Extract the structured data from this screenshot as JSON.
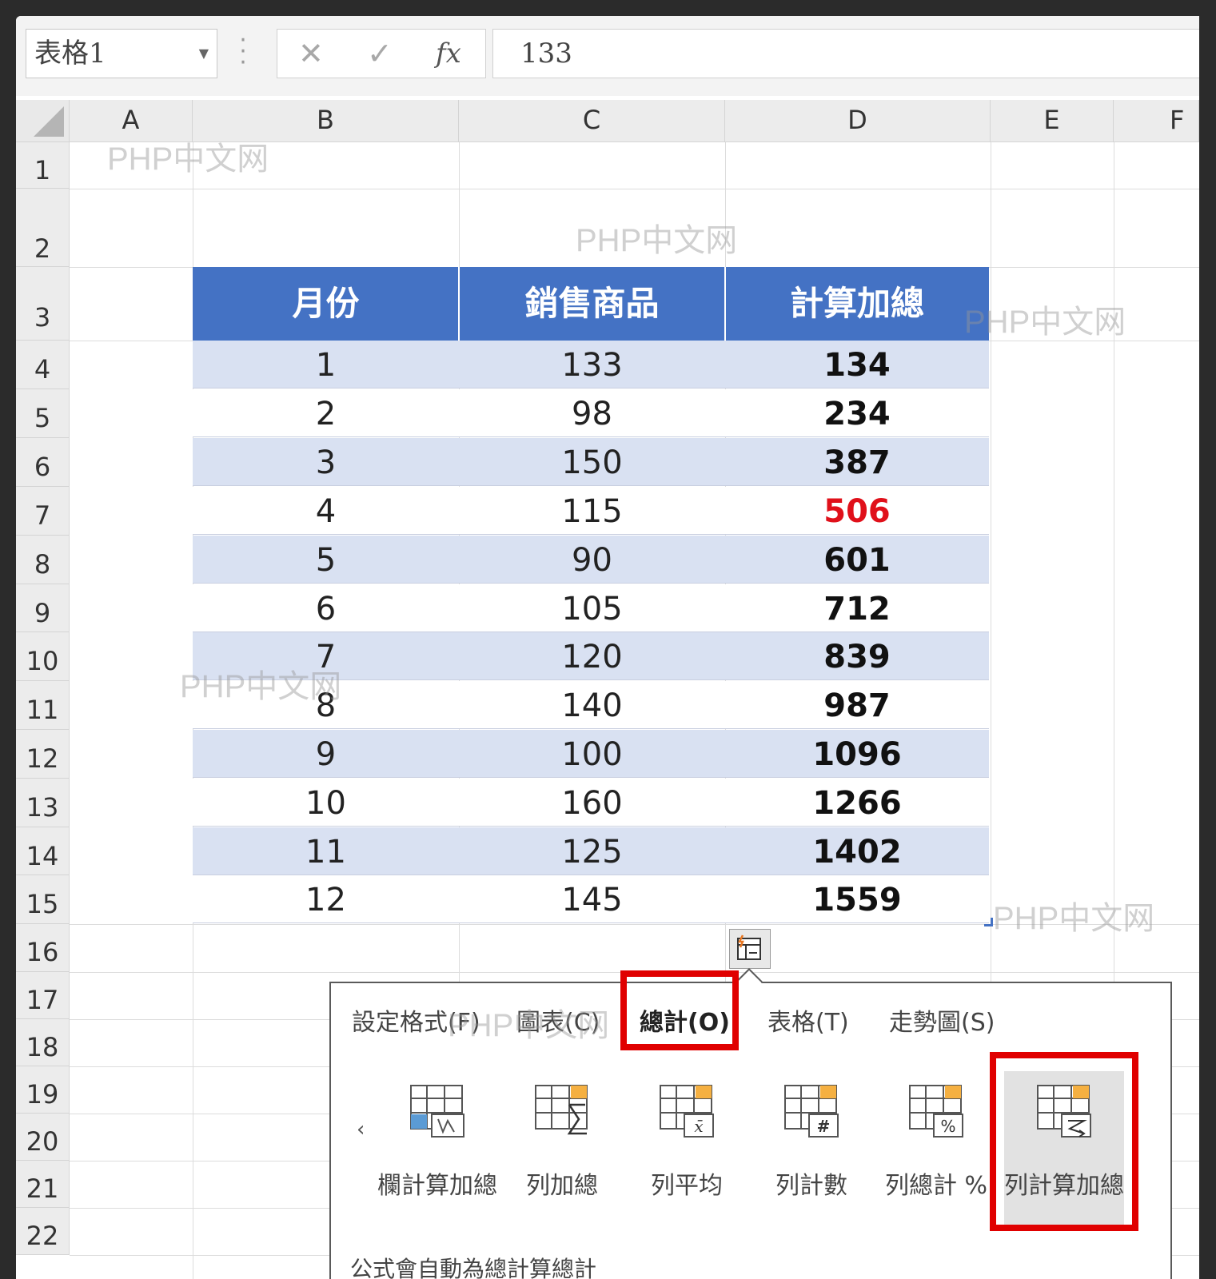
{
  "formula_bar": {
    "name_box": "表格1",
    "cancel_symbol": "✕",
    "enter_symbol": "✓",
    "fx_label": "fx",
    "formula_value": "133"
  },
  "columns": [
    "A",
    "B",
    "C",
    "D",
    "E",
    "F"
  ],
  "rows": [
    "1",
    "2",
    "3",
    "4",
    "5",
    "6",
    "7",
    "8",
    "9",
    "10",
    "11",
    "12",
    "13",
    "14",
    "15",
    "16",
    "17",
    "18",
    "19",
    "20",
    "21",
    "22"
  ],
  "table": {
    "headers": [
      "月份",
      "銷售商品",
      "計算加總"
    ],
    "rows": [
      [
        "1",
        "133",
        "134"
      ],
      [
        "2",
        "98",
        "234"
      ],
      [
        "3",
        "150",
        "387"
      ],
      [
        "4",
        "115",
        "506"
      ],
      [
        "5",
        "90",
        "601"
      ],
      [
        "6",
        "105",
        "712"
      ],
      [
        "7",
        "120",
        "839"
      ],
      [
        "8",
        "140",
        "987"
      ],
      [
        "9",
        "100",
        "1096"
      ],
      [
        "10",
        "160",
        "1266"
      ],
      [
        "11",
        "125",
        "1402"
      ],
      [
        "12",
        "145",
        "1559"
      ]
    ],
    "highlight_color": "#e0101a",
    "header_color": "#4472c4",
    "band_color": "#d9e1f2"
  },
  "quick_analysis": {
    "tabs": [
      "設定格式(F)",
      "圖表(C)",
      "總計(O)",
      "表格(T)",
      "走勢圖(S)"
    ],
    "active_tab": "總計(O)",
    "items": [
      "欄計算加總",
      "列加總",
      "列平均",
      "列計數",
      "列總計 %",
      "列計算加總"
    ],
    "selected_item": "列計算加總",
    "footer_text": "公式會自動為總計算總計",
    "highlight_color": "#e00000"
  },
  "watermark": "PHP中文网"
}
